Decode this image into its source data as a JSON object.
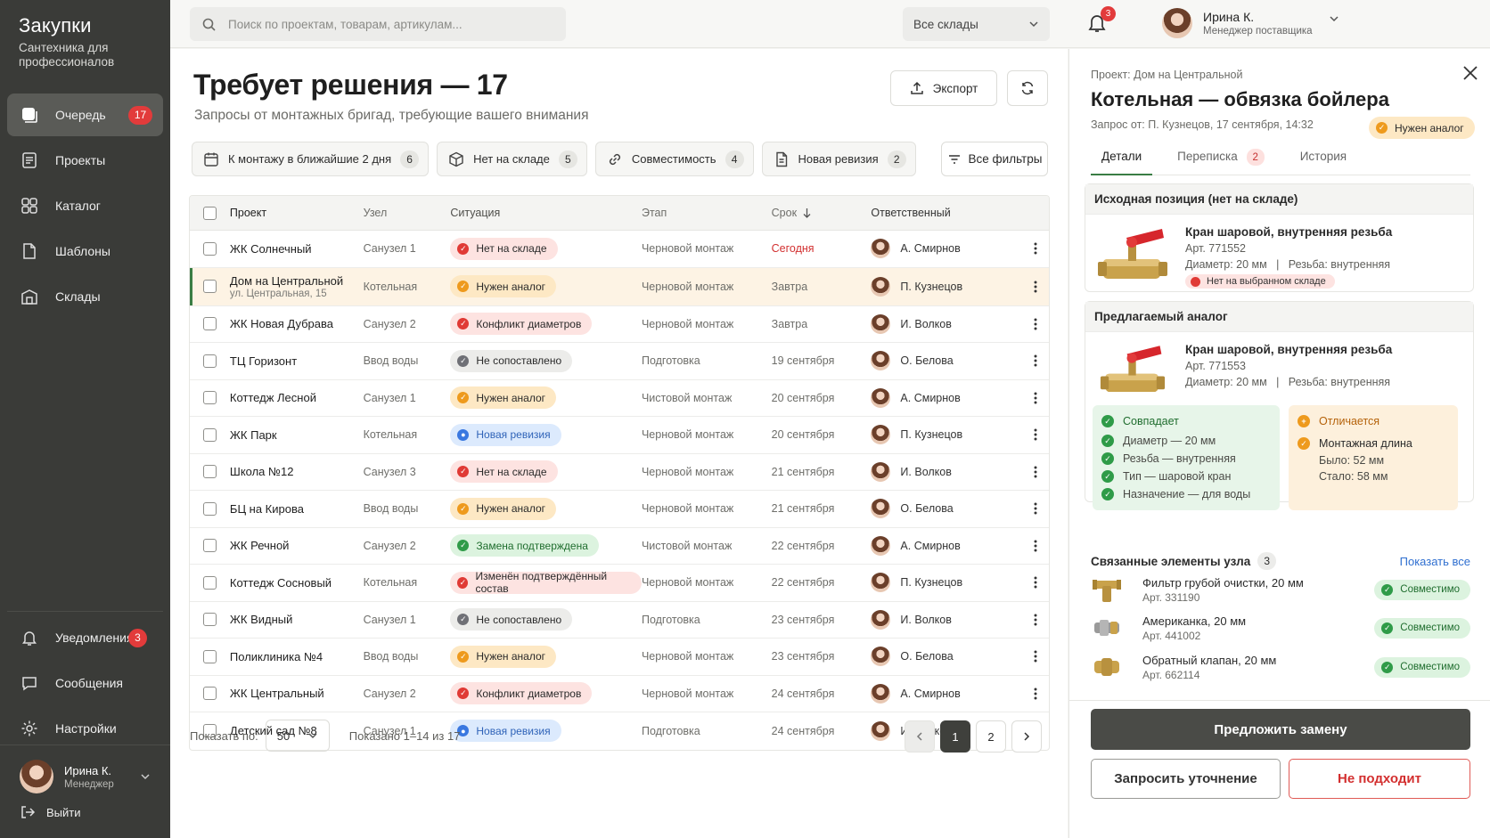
{
  "brand": {
    "title": "Закупки",
    "subtitle": "Сантехника для профессионалов"
  },
  "sidebar": {
    "items": [
      {
        "label": "Очередь",
        "badge": "17",
        "icon": "queue-icon"
      },
      {
        "label": "Проекты",
        "icon": "projects-icon"
      },
      {
        "label": "Каталог",
        "icon": "catalog-icon"
      },
      {
        "label": "Шаблоны",
        "icon": "template-icon"
      },
      {
        "label": "Склады",
        "icon": "warehouse-icon"
      }
    ],
    "bottom": [
      {
        "label": "Уведомления",
        "badge": "3",
        "icon": "bell-icon"
      },
      {
        "label": "Сообщения",
        "icon": "message-icon"
      },
      {
        "label": "Настройки",
        "icon": "gear-icon"
      }
    ],
    "user": {
      "name": "Ирина К.",
      "role": "Менеджер",
      "logout": "Выйти"
    }
  },
  "topbar": {
    "search_placeholder": "Поиск по проектам, товарам, артикулам...",
    "warehouse": "Все склады",
    "notifications": "3",
    "user": {
      "name": "Ирина К.",
      "role": "Менеджер поставщика"
    }
  },
  "main": {
    "title": "Требует решения — 17",
    "subtitle": "Запросы от монтажных бригад, требующие вашего внимания",
    "export_label": "Экспорт",
    "filters_label": "Все фильтры",
    "chips": [
      {
        "label": "К монтажу в ближайшие 2 дня",
        "count": "6",
        "icon": "calendar-icon"
      },
      {
        "label": "Нет на складе",
        "count": "5",
        "icon": "box-icon"
      },
      {
        "label": "Совместимость",
        "count": "4",
        "icon": "link-icon"
      },
      {
        "label": "Новая ревизия",
        "count": "2",
        "icon": "document-icon"
      }
    ],
    "columns": [
      "Проект",
      "Узел",
      "Ситуация",
      "Этап",
      "Срок",
      "Ответственный"
    ],
    "rows": [
      {
        "project": "ЖК Солнечный",
        "node": "Санузел 1",
        "situation": "Нет на складе",
        "color": "red",
        "stage": "Черновой монтаж",
        "due": "Сегодня",
        "resp": "А. Смирнов"
      },
      {
        "project": "Дом на Центральной",
        "address": "ул. Центральная, 15",
        "node": "Котельная",
        "situation": "Нужен аналог",
        "color": "orange",
        "stage": "Черновой монтаж",
        "due": "Завтра",
        "resp": "П. Кузнецов"
      },
      {
        "project": "ЖК Новая Дубрава",
        "node": "Санузел 2",
        "situation": "Конфликт диаметров",
        "color": "red",
        "stage": "Черновой монтаж",
        "due": "Завтра",
        "resp": "И. Волков"
      },
      {
        "project": "ТЦ Горизонт",
        "node": "Ввод воды",
        "situation": "Не сопоставлено",
        "color": "grey",
        "stage": "Подготовка",
        "due": "19 сентября",
        "resp": "О. Белова"
      },
      {
        "project": "Коттедж Лесной",
        "node": "Санузел 1",
        "situation": "Нужен аналог",
        "color": "orange",
        "stage": "Чистовой монтаж",
        "due": "20 сентября",
        "resp": "А. Смирнов"
      },
      {
        "project": "ЖК Парк",
        "node": "Котельная",
        "situation": "Новая ревизия",
        "color": "blue",
        "stage": "Черновой монтаж",
        "due": "20 сентября",
        "resp": "П. Кузнецов"
      },
      {
        "project": "Школа №12",
        "node": "Санузел 3",
        "situation": "Нет на складе",
        "color": "red",
        "stage": "Черновой монтаж",
        "due": "21 сентября",
        "resp": "И. Волков"
      },
      {
        "project": "БЦ на Кирова",
        "node": "Ввод воды",
        "situation": "Нужен аналог",
        "color": "orange",
        "stage": "Черновой монтаж",
        "due": "21 сентября",
        "resp": "О. Белова"
      },
      {
        "project": "ЖК Речной",
        "node": "Санузел 2",
        "situation": "Замена подтверждена",
        "color": "green",
        "stage": "Чистовой монтаж",
        "due": "22 сентября",
        "resp": "А. Смирнов"
      },
      {
        "project": "Коттедж Сосновый",
        "node": "Котельная",
        "situation": "Изменён подтверждённый состав",
        "color": "red",
        "stage": "Черновой монтаж",
        "due": "22 сентября",
        "resp": "П. Кузнецов"
      },
      {
        "project": "ЖК Видный",
        "node": "Санузел 1",
        "situation": "Не сопоставлено",
        "color": "grey",
        "stage": "Подготовка",
        "due": "23 сентября",
        "resp": "И. Волков"
      },
      {
        "project": "Поликлиника №4",
        "node": "Ввод воды",
        "situation": "Нужен аналог",
        "color": "orange",
        "stage": "Черновой монтаж",
        "due": "23 сентября",
        "resp": "О. Белова"
      },
      {
        "project": "ЖК Центральный",
        "node": "Санузел 2",
        "situation": "Конфликт диаметров",
        "color": "red",
        "stage": "Черновой монтаж",
        "due": "24 сентября",
        "resp": "А. Смирнов"
      },
      {
        "project": "Детский сад №8",
        "node": "Санузел 1",
        "situation": "Новая ревизия",
        "color": "blue",
        "stage": "Подготовка",
        "due": "24 сентября",
        "resp": "И. Волков"
      }
    ],
    "page_size_label": "Показать по:",
    "page_size": "50",
    "shown": "Показано 1–14 из 17",
    "pages": [
      "1",
      "2"
    ]
  },
  "panel": {
    "project": "Проект: Дом на Центральной",
    "title": "Котельная — обвязка бойлера",
    "from": "Запрос от: П. Кузнецов, 17 сентября, 14:32",
    "tag": "Нужен аналог",
    "tabs": [
      {
        "label": "Детали"
      },
      {
        "label": "Переписка",
        "count": "2"
      },
      {
        "label": "История"
      }
    ],
    "source": {
      "heading": "Исходная позиция (нет на складе)",
      "name": "Кран шаровой, внутренняя резьба",
      "art": "Арт. 771552",
      "specs": "Диаметр: 20 мм   |   Резьба: внутренняя",
      "warning": "Нет на выбранном складе"
    },
    "analog": {
      "heading": "Предлагаемый аналог",
      "name": "Кран шаровой, внутренняя резьба",
      "art": "Арт. 771553",
      "specs": "Диаметр: 20 мм   |   Резьба: внутренняя",
      "match_title": "Совпадает",
      "matches": [
        "Диаметр — 20 мм",
        "Резьба — внутренняя",
        "Тип — шаровой кран",
        "Назначение — для воды"
      ],
      "diff_title": "Отличается",
      "diff_name": "Монтажная длина",
      "diff_was": "Было: 52 мм",
      "diff_now": "Стало: 58 мм"
    },
    "related": {
      "heading": "Связанные элементы узла",
      "count": "3",
      "show_all": "Показать все",
      "items": [
        {
          "name": "Фильтр грубой очистки, 20 мм",
          "art": "Арт. 331190",
          "status": "Совместимо"
        },
        {
          "name": "Американка, 20 мм",
          "art": "Арт. 441002",
          "status": "Совместимо"
        },
        {
          "name": "Обратный клапан, 20 мм",
          "art": "Арт. 662114",
          "status": "Совместимо"
        }
      ]
    },
    "primary": "Предложить замену",
    "clarify": "Запросить уточнение",
    "reject": "Не подходит"
  }
}
